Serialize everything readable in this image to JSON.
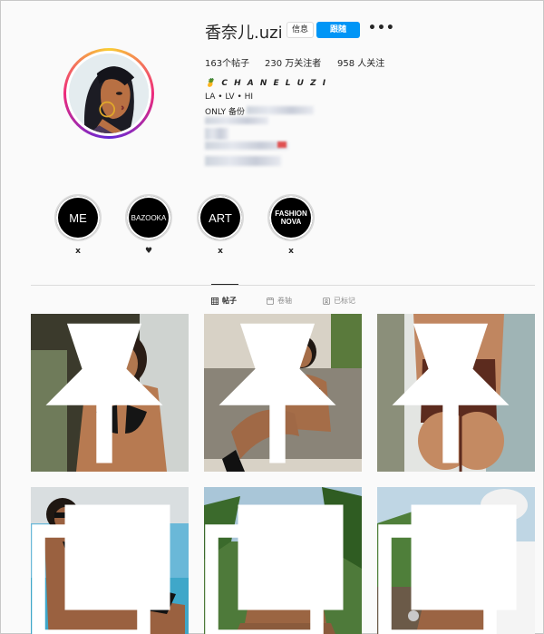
{
  "profile": {
    "username": "香奈儿.uzi",
    "message_label": "信息",
    "follow_label": "跟随",
    "more_label": "•••",
    "stats": {
      "posts": "163个帖子",
      "followers": "230 万关注者",
      "following": "958 人关注"
    },
    "bio": {
      "name": "🍍 C H A N E L U Z I",
      "line1": "LA • LV • HI",
      "line2": "ONLY 备份"
    }
  },
  "highlights": [
    {
      "title": "ME",
      "label": "x"
    },
    {
      "title": "BAZOOKA",
      "label": "♥"
    },
    {
      "title": "ART",
      "label": "x"
    },
    {
      "title": "FASHION NOVA",
      "label": "x"
    }
  ],
  "tabs": [
    {
      "label": "帖子",
      "icon": "grid-icon",
      "active": true
    },
    {
      "label": "卷轴",
      "icon": "reels-icon",
      "active": false
    },
    {
      "label": "已标记",
      "icon": "tag-icon",
      "active": false
    }
  ],
  "posts": [
    {
      "badge": "pin-icon"
    },
    {
      "badge": "pin-icon"
    },
    {
      "badge": "pin-icon"
    },
    {
      "badge": "carousel-icon"
    },
    {
      "badge": "carousel-icon"
    },
    {
      "badge": "carousel-icon"
    }
  ],
  "colors": {
    "follow_button": "#0095f6",
    "background": "#fafafa",
    "border": "#dbdbdb"
  }
}
